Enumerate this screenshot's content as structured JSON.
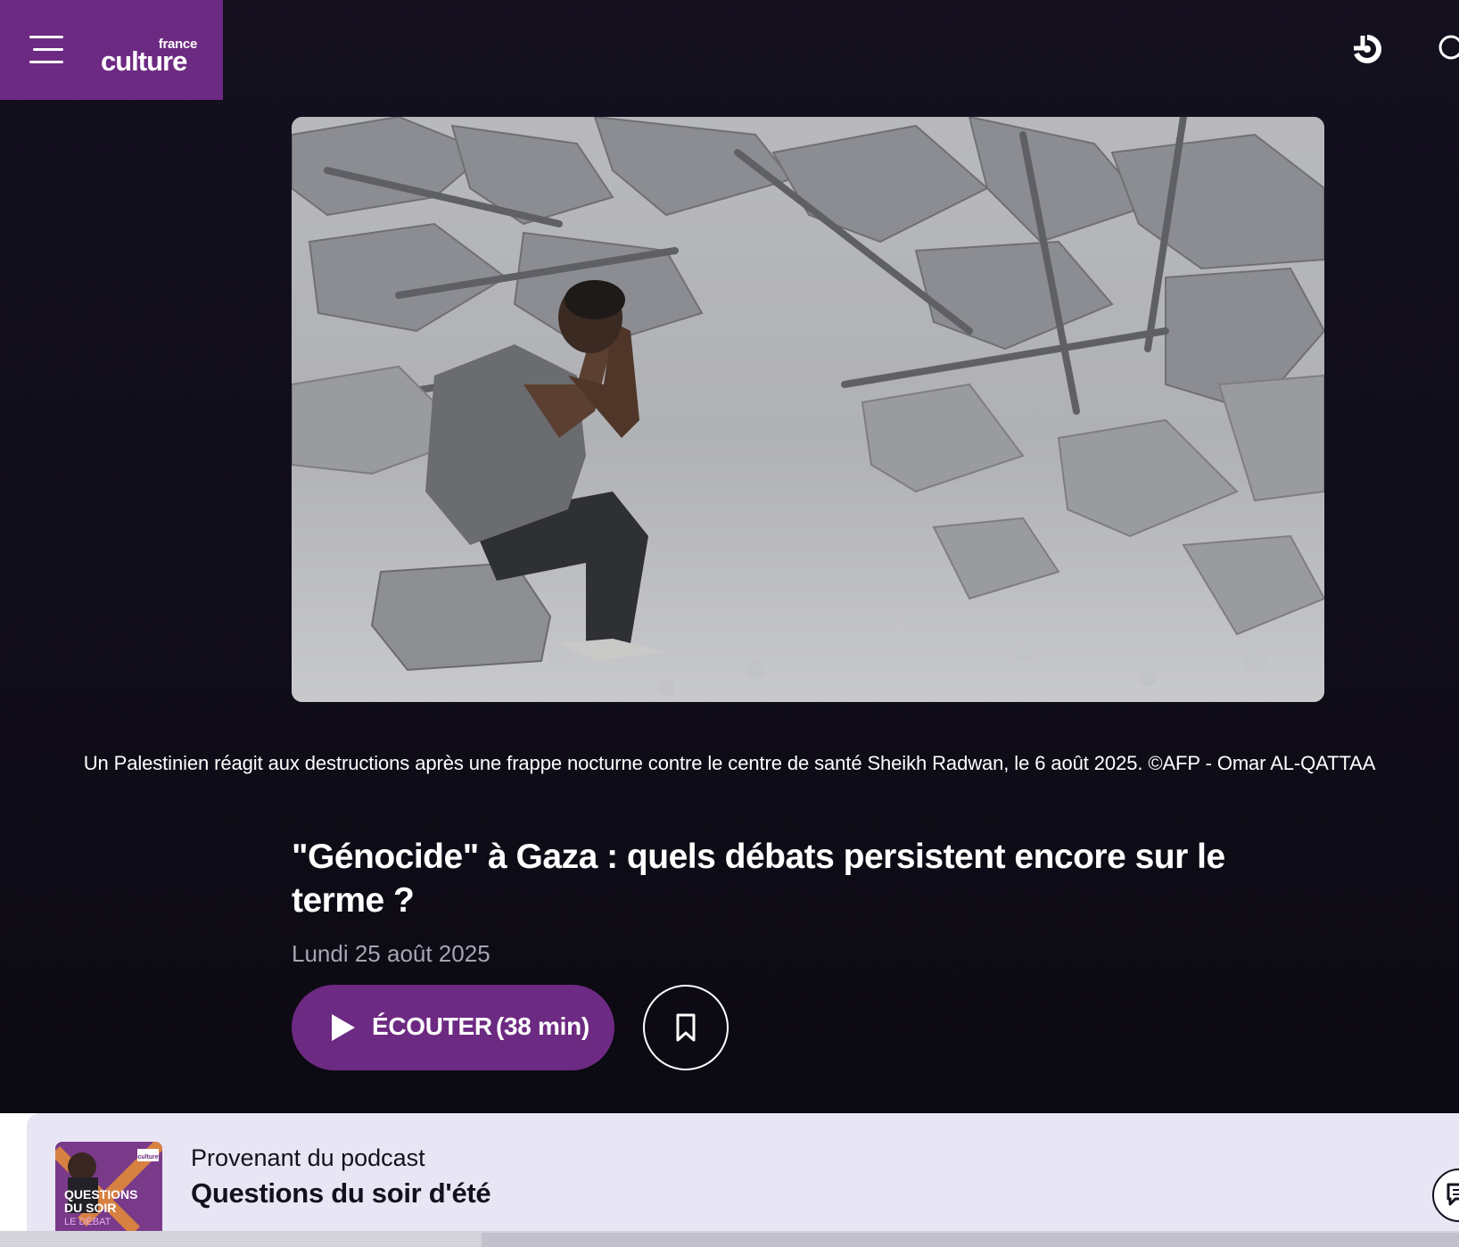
{
  "header": {
    "logo_small": "france",
    "logo_big": "culture",
    "brand_color": "#6d2a82"
  },
  "hero": {
    "caption": "Un Palestinien réagit aux destructions après une frappe nocturne contre le centre de santé Sheikh Radwan, le 6 août 2025. ©AFP - Omar AL-QATTAA"
  },
  "article": {
    "title": "\"Génocide\" à Gaza : quels débats persistent encore sur le terme ?",
    "date": "Lundi 25 août 2025",
    "listen_label": "ÉCOUTER",
    "listen_duration": "(38 min)"
  },
  "podcast": {
    "from_label": "Provenant du podcast",
    "title": "Questions du soir d'été",
    "thumb_line1": "QUESTIONS",
    "thumb_line2": "DU SOIR",
    "thumb_line3": "LE DÉBAT",
    "thumb_brand": "culture"
  },
  "icons": {
    "menu": "hamburger-icon",
    "radio": "live-radio-icon",
    "search": "search-icon",
    "play": "play-icon",
    "bookmark": "bookmark-icon",
    "chat": "chat-icon"
  }
}
